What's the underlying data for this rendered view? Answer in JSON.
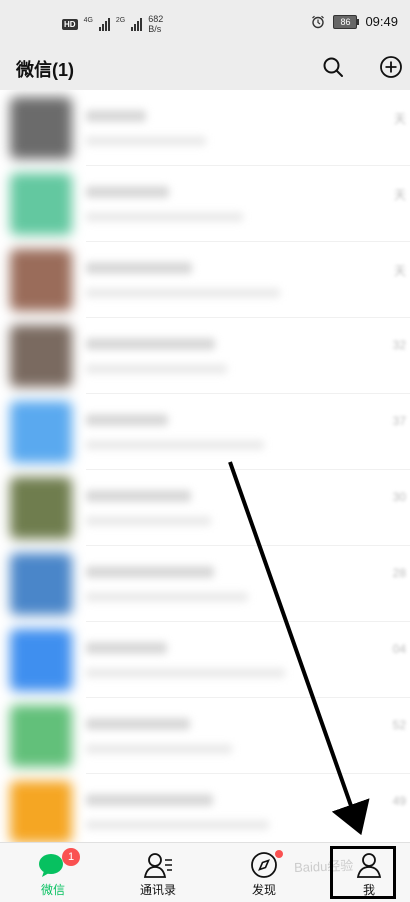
{
  "status_bar": {
    "hd": "HD",
    "net1": "4G",
    "net2": "2G",
    "speed_value": "682",
    "speed_unit": "B/s",
    "battery": "86",
    "time": "09:49"
  },
  "header": {
    "title": "微信(1)",
    "search_icon": "search-icon",
    "add_icon": "plus-circle-icon"
  },
  "chats": [
    {
      "avatar_color": "#6b6b6b",
      "time": "天"
    },
    {
      "avatar_color": "#63c8a0",
      "time": "天"
    },
    {
      "avatar_color": "#9a6c5a",
      "time": "天"
    },
    {
      "avatar_color": "#7a6a60",
      "time": "32"
    },
    {
      "avatar_color": "#5aa9ef",
      "time": "37"
    },
    {
      "avatar_color": "#6f7d4e",
      "time": "30"
    },
    {
      "avatar_color": "#4a86c9",
      "time": "28"
    },
    {
      "avatar_color": "#3f8fef",
      "time": "04"
    },
    {
      "avatar_color": "#62c07a",
      "time": "52"
    },
    {
      "avatar_color": "#f5a623",
      "time": "49"
    }
  ],
  "tabs": [
    {
      "label": "微信",
      "icon": "chat-bubble-icon",
      "badge": "1"
    },
    {
      "label": "通讯录",
      "icon": "contacts-icon"
    },
    {
      "label": "发现",
      "icon": "compass-icon"
    },
    {
      "label": "我",
      "icon": "person-icon"
    }
  ],
  "watermark": "Baidu经验",
  "colors": {
    "accent": "#07c160",
    "badge": "#fa5151",
    "background": "#ededed"
  }
}
